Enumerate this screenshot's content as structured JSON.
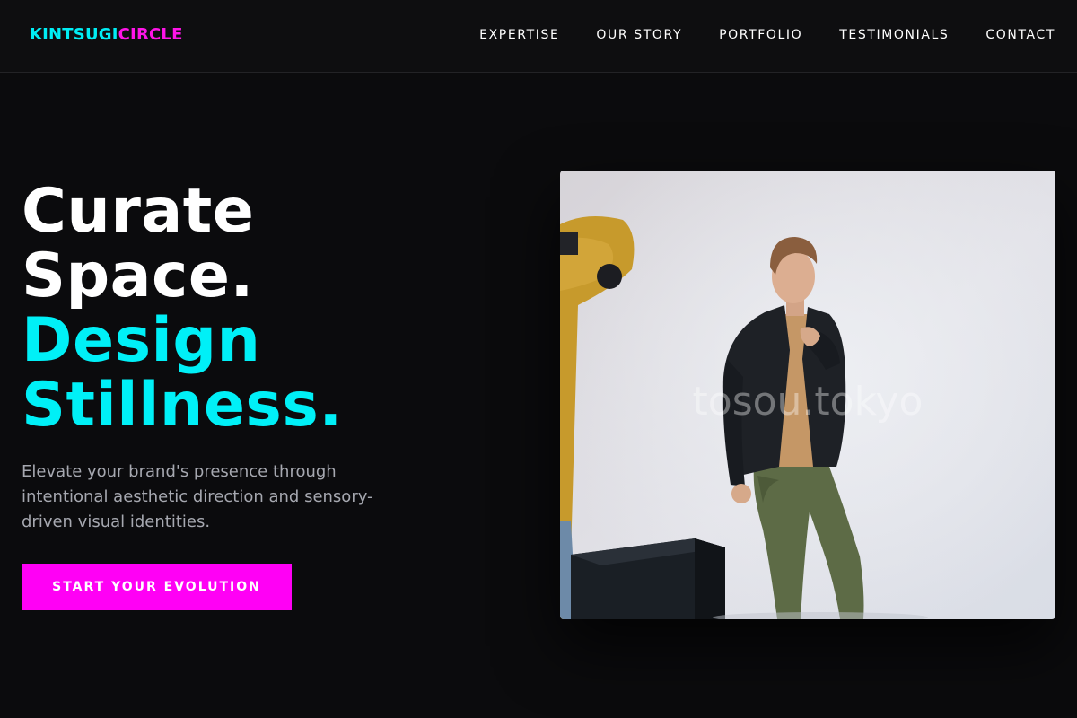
{
  "brand": {
    "part1": "KINTSUGI",
    "part2": "CIRCLE"
  },
  "nav": {
    "items": [
      {
        "label": "EXPERTISE"
      },
      {
        "label": "OUR STORY"
      },
      {
        "label": "PORTFOLIO"
      },
      {
        "label": "TESTIMONIALS"
      },
      {
        "label": "CONTACT"
      }
    ]
  },
  "hero": {
    "title_line1": "Curate",
    "title_line2": "Space.",
    "title_line3": "Design",
    "title_line4": "Stillness.",
    "subtitle": "Elevate your brand's presence through intentional aesthetic direction and sensory-driven visual identities.",
    "cta_label": "START YOUR EVOLUTION"
  },
  "image": {
    "watermark": "tosou.tokyo"
  },
  "colors": {
    "background": "#0b0b0d",
    "accent_cyan": "#00f0f7",
    "accent_magenta": "#ff00f5",
    "body_text": "#a6a8b0"
  }
}
